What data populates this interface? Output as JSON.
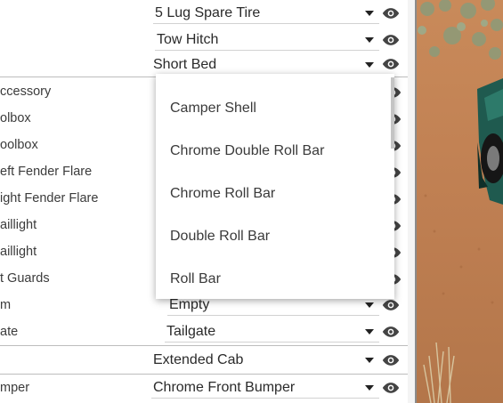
{
  "rows": [
    {
      "label": "",
      "value": "5 Lug Spare Tire"
    },
    {
      "label": "",
      "value": "Tow Hitch"
    },
    {
      "label": "",
      "value": "Short Bed"
    },
    {
      "label": "ccessory",
      "value": ""
    },
    {
      "label": "olbox",
      "value": ""
    },
    {
      "label": "oolbox",
      "value": ""
    },
    {
      "label": "eft Fender Flare",
      "value": ""
    },
    {
      "label": "ight Fender Flare",
      "value": ""
    },
    {
      "label": "aillight",
      "value": ""
    },
    {
      "label": "aillight",
      "value": ""
    },
    {
      "label": "t Guards",
      "value": ""
    },
    {
      "label": "m",
      "value": "Empty"
    },
    {
      "label": "ate",
      "value": "Tailgate"
    },
    {
      "label": "",
      "value": "Extended Cab"
    },
    {
      "label": "mper",
      "value": "Chrome Front Bumper"
    }
  ],
  "dropdown": {
    "options": [
      "Camper Shell",
      "Chrome Double Roll Bar",
      "Chrome Roll Bar",
      "Double Roll Bar",
      "Roll Bar"
    ]
  },
  "icons": {
    "visibility": "eye-icon",
    "expand": "caret-down-icon"
  },
  "colors": {
    "panel_bg": "#ffffff",
    "separator": "#bdbdbd",
    "divider": "#8b8b8b",
    "sand": "#c98a5a",
    "truck": "#1f5a4f"
  }
}
